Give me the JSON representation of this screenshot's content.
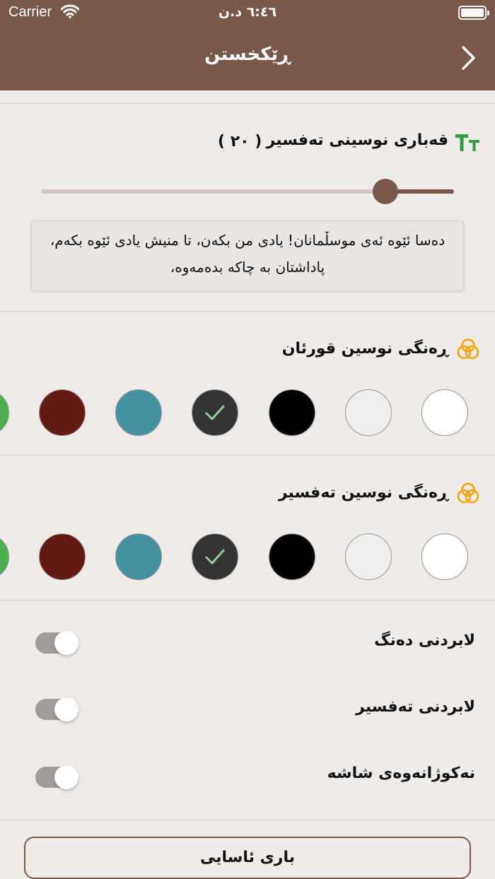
{
  "status_bar": {
    "carrier": "Carrier",
    "time": "٦:٤٦ د.ن",
    "wifi_icon": "wifi-icon",
    "battery_icon": "battery-icon"
  },
  "nav": {
    "title": "ڕێکخستن",
    "back_icon": "chevron-right-icon"
  },
  "font_size": {
    "title": "قەباری نوسینی تەفسیر",
    "value": "( ٢٠ )",
    "icon": "text-size-icon",
    "slider_fraction": 0.834,
    "accent_color": "#7a5849",
    "preview_text": "دەسا ئێوە ئەی موسڵمانان! یادی من بکەن، تا منیش یادی ئێوە بکەم، پاداشتان بە چاکە بدەمەوە،"
  },
  "quran_color": {
    "title": "ڕەنگی نوسین قورئان",
    "icon": "color-rings-icon",
    "icon_color": "#f5a300",
    "swatches": [
      "#ffffff",
      "#efefef",
      "#000000",
      "#333333",
      "#4390a0",
      "#621a12",
      "#4caf50"
    ],
    "selected_index": 3
  },
  "tafsir_color": {
    "title": "ڕەنگی نوسین تەفسیر",
    "icon": "color-rings-icon",
    "icon_color": "#f5a300",
    "swatches": [
      "#ffffff",
      "#efefef",
      "#000000",
      "#333333",
      "#4390a0",
      "#621a12",
      "#4caf50"
    ],
    "selected_index": 3
  },
  "toggles": [
    {
      "label": "لابردنی دەنگ",
      "on": false
    },
    {
      "label": "لابردنی تەفسیر",
      "on": false
    },
    {
      "label": "نەکوژانەوەی شاشە",
      "on": false
    }
  ],
  "reset_button": {
    "label": "باری ئاسایی"
  }
}
